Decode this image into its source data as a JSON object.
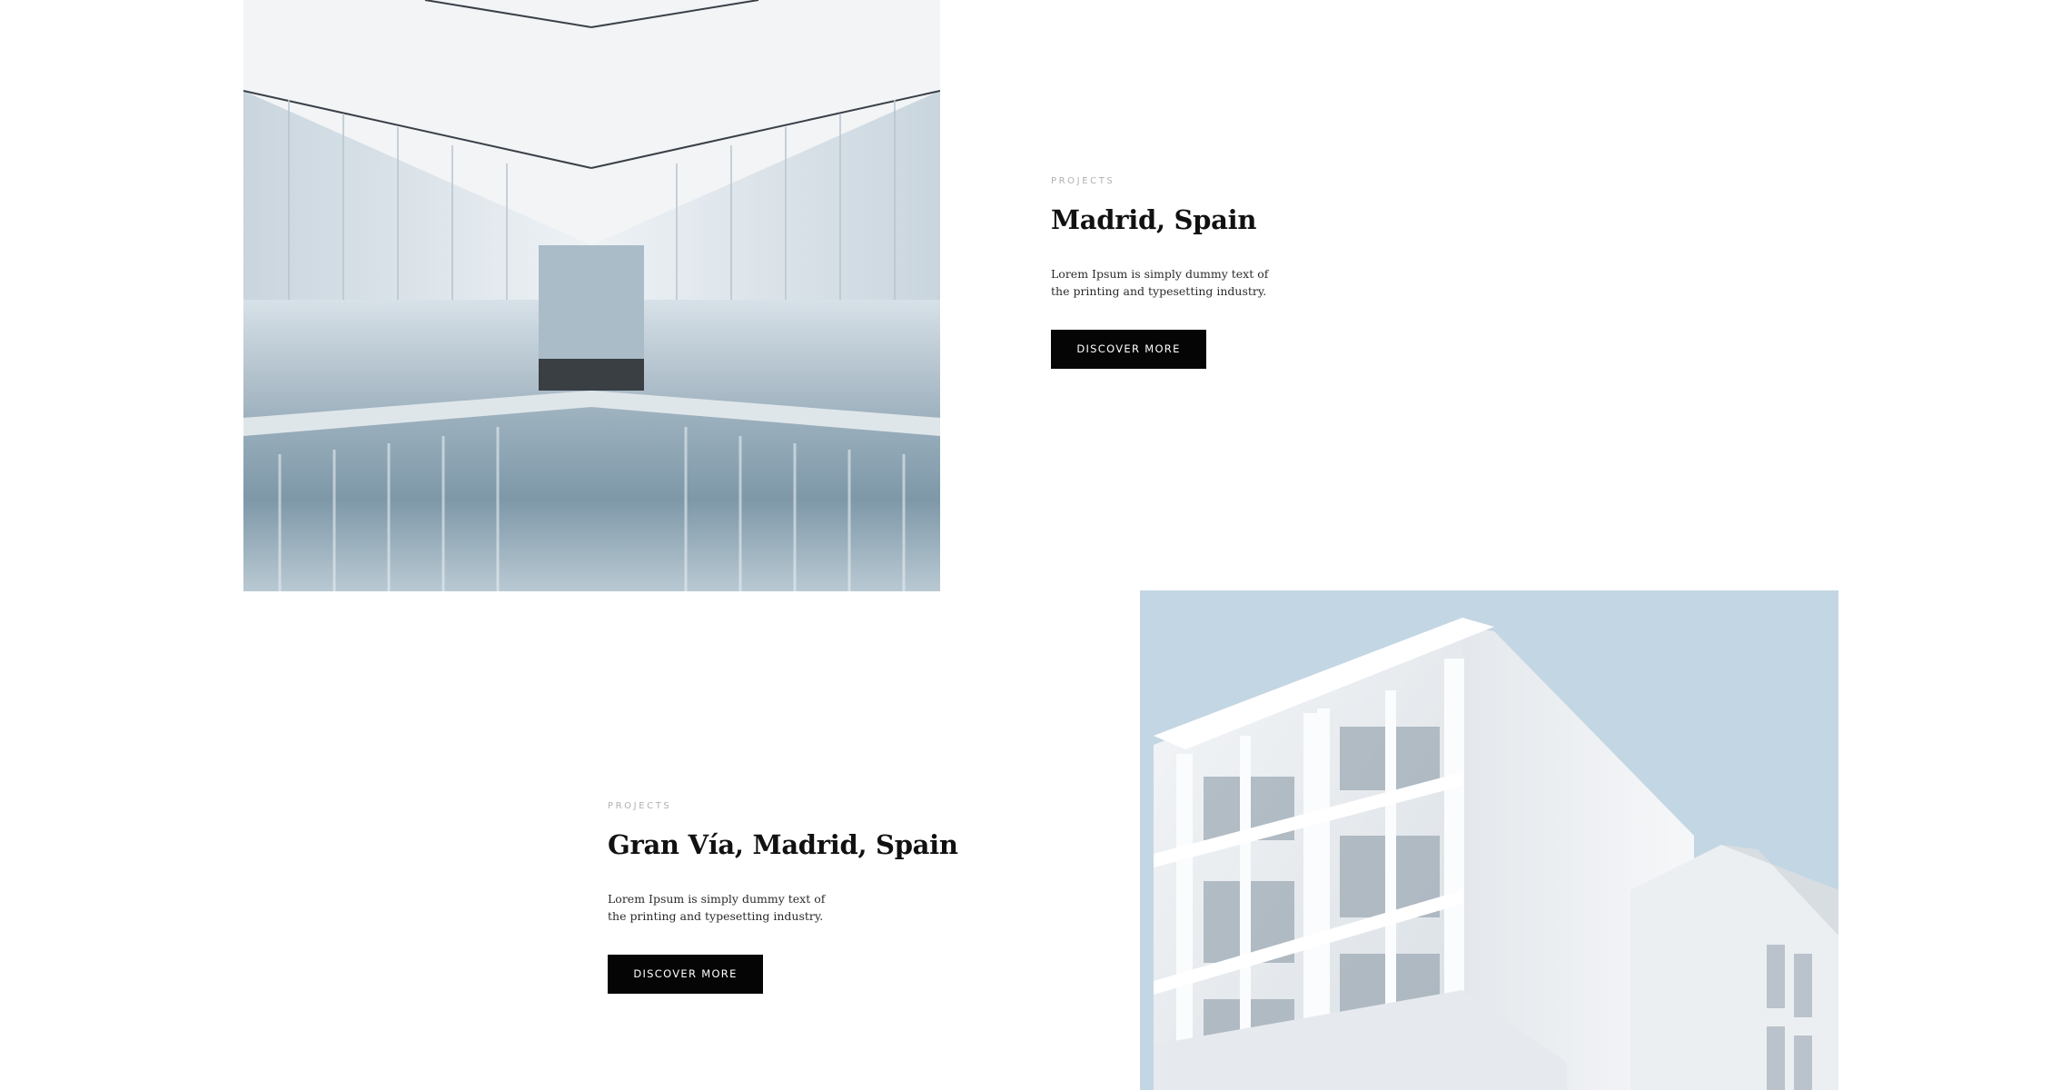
{
  "projects": [
    {
      "eyebrow": "PROJECTS",
      "title": "Madrid, Spain",
      "description": "Lorem Ipsum is simply dummy text of the printing and typesetting industry.",
      "button_label": "DISCOVER MORE",
      "image": "indoor-reflecting-pool-architecture-photo"
    },
    {
      "eyebrow": "PROJECTS",
      "title": "Gran Vía, Madrid, Spain",
      "description": "Lorem Ipsum is simply dummy text of the printing and typesetting industry.",
      "button_label": "DISCOVER MORE",
      "image": "white-modern-building-facade-photo"
    }
  ],
  "colors": {
    "button_bg": "#050505",
    "button_text": "#ffffff",
    "heading": "#111111",
    "eyebrow": "#b0b0b0",
    "sky": "#c3d6e3"
  }
}
